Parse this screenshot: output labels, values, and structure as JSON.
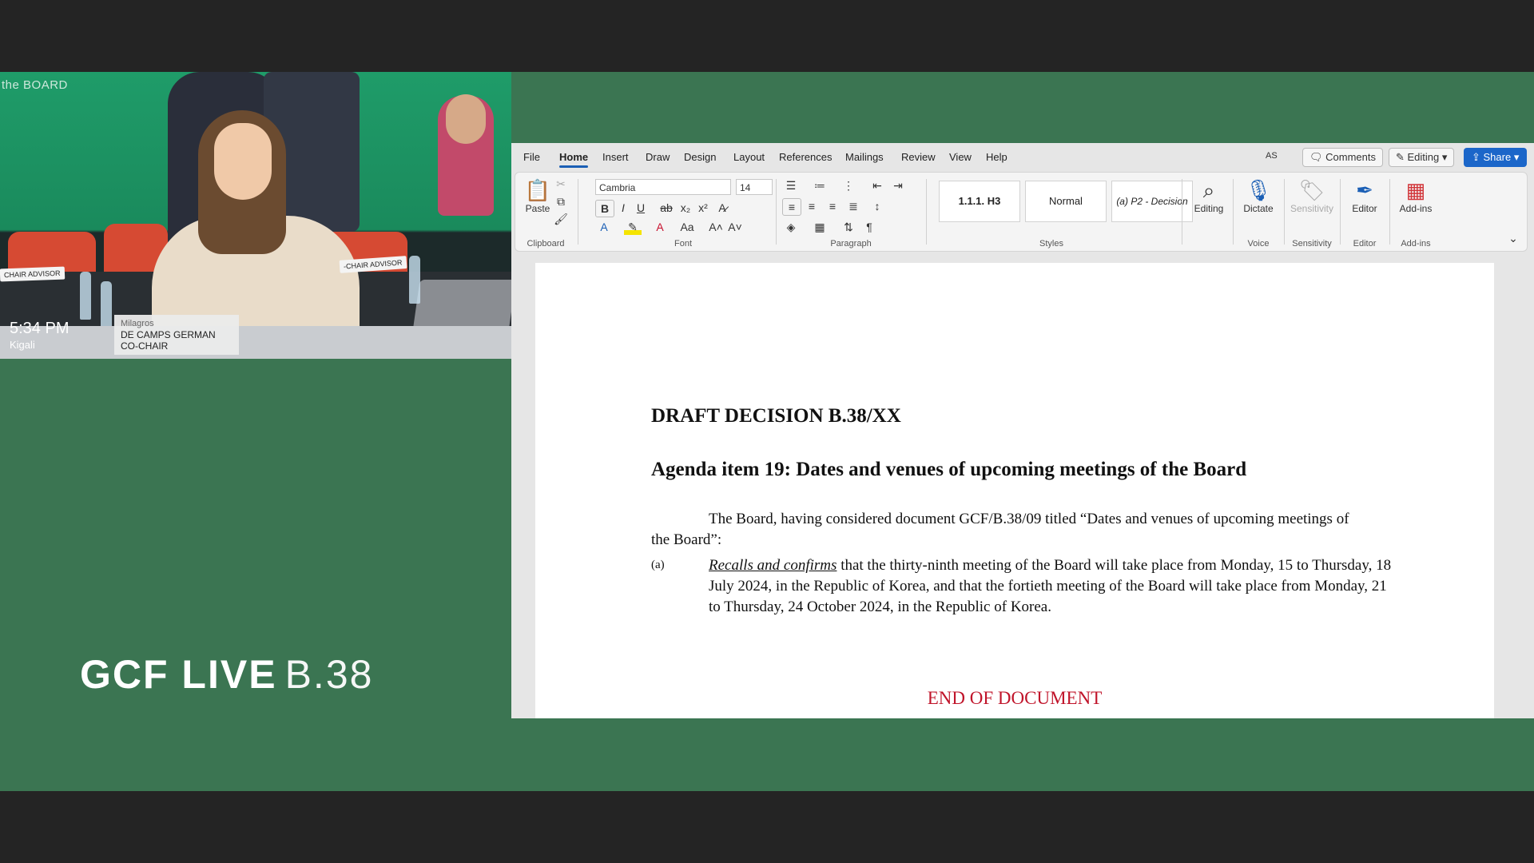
{
  "camera": {
    "wall_text": "the BOARD",
    "time": "5:34 PM",
    "city": "Kigali",
    "nameplate_left": "CHAIR ADVISOR",
    "nameplate_right": "-CHAIR ADVISOR",
    "speaker": {
      "first_name": "Milagros",
      "last_name": "DE CAMPS GERMAN",
      "role": "CO-CHAIR"
    }
  },
  "brand": {
    "main": "GCF LIVE",
    "suffix": "B.38"
  },
  "word": {
    "menu": [
      "File",
      "Home",
      "Insert",
      "Draw",
      "Design",
      "Layout",
      "References",
      "Mailings",
      "Review",
      "View",
      "Help"
    ],
    "active_menu": "Home",
    "avatar": "AS",
    "comments_label": "Comments",
    "editing_label": "Editing",
    "share_label": "Share",
    "ribbon": {
      "paste_label": "Paste",
      "clipboard_label": "Clipboard",
      "font_name": "Cambria",
      "font_size": "14",
      "font_label": "Font",
      "paragraph_label": "Paragraph",
      "styles": [
        "1.1.1. H3",
        "Normal",
        "(a) P2 - Decision"
      ],
      "styles_label": "Styles",
      "editing_btn": "Editing",
      "dictate_btn": "Dictate",
      "voice_label": "Voice",
      "sensitivity_btn": "Sensitivity",
      "sensitivity_label": "Sensitivity",
      "editor_btn": "Editor",
      "editor_label": "Editor",
      "addins_btn": "Add-ins",
      "addins_label": "Add-ins"
    },
    "document": {
      "title": "DRAFT DECISION B.38/XX",
      "heading": "Agenda item 19: Dates and venues of upcoming meetings of the Board",
      "intro": "The Board, having considered document GCF/B.38/09 titled “Dates and venues of upcoming meetings of the Board”:",
      "item_label": "(a)",
      "item_lead": "Recalls and confirms",
      "item_text": " that the thirty-ninth meeting of the Board will take place from Monday, 15 to Thursday, 18 July 2024, in the Republic of Korea, and that the fortieth meeting of the Board will take place from Monday, 21 to Thursday, 24 October 2024, in the Republic of Korea.",
      "end": "END OF DOCUMENT"
    }
  }
}
